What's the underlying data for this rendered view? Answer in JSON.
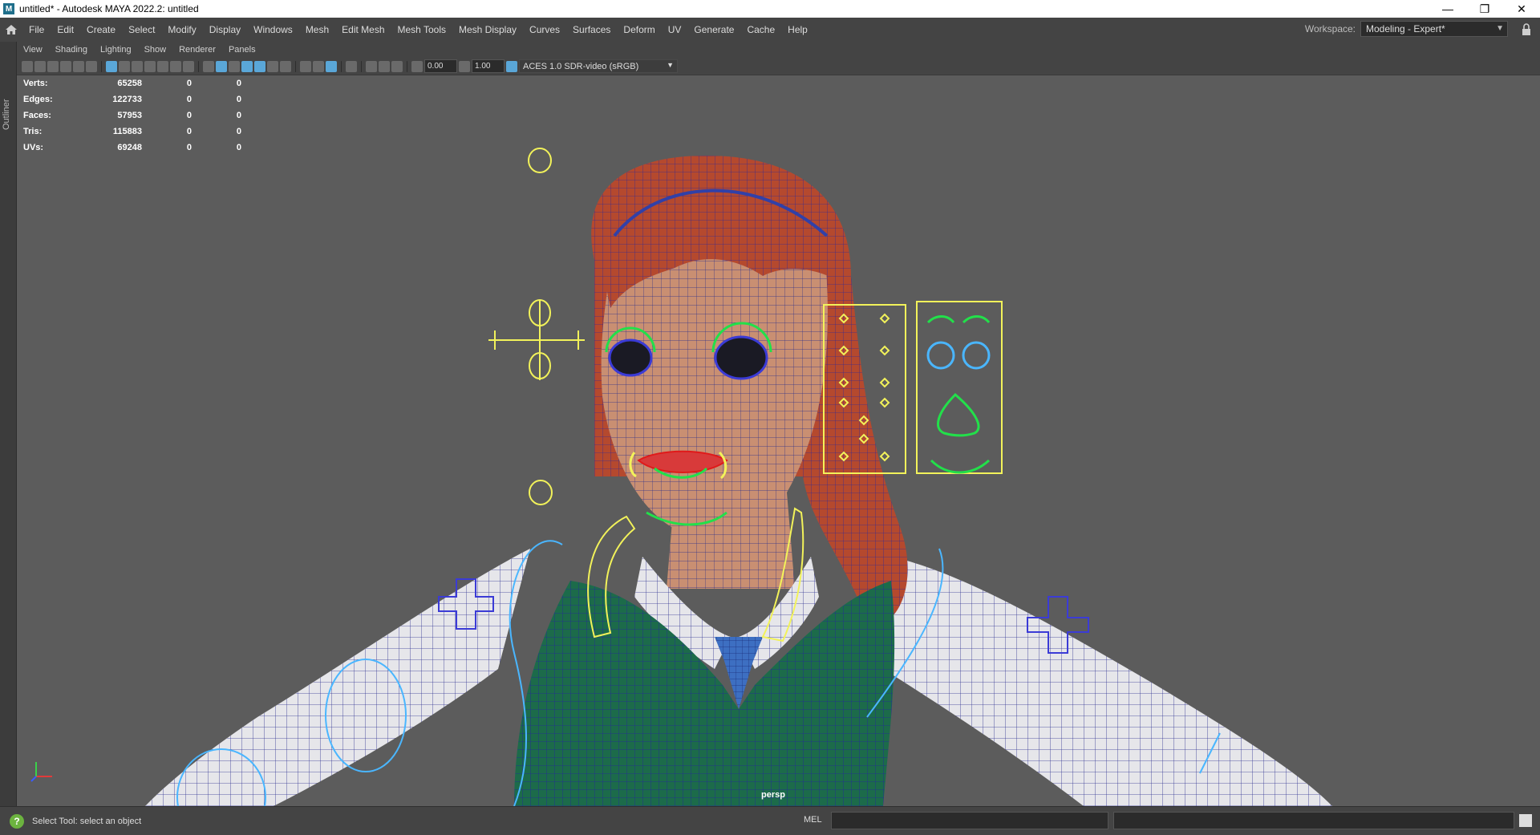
{
  "window": {
    "title": "untitled* - Autodesk MAYA 2022.2: untitled",
    "app_icon": "M"
  },
  "menu": {
    "items": [
      "File",
      "Edit",
      "Create",
      "Select",
      "Modify",
      "Display",
      "Windows",
      "Mesh",
      "Edit Mesh",
      "Mesh Tools",
      "Mesh Display",
      "Curves",
      "Surfaces",
      "Deform",
      "UV",
      "Generate",
      "Cache",
      "Help"
    ]
  },
  "workspace": {
    "label": "Workspace:",
    "value": "Modeling - Expert*"
  },
  "outliner": {
    "label": "Outliner"
  },
  "panel_menu": {
    "items": [
      "View",
      "Shading",
      "Lighting",
      "Show",
      "Renderer",
      "Panels"
    ]
  },
  "toolbar": {
    "exposure": "0.00",
    "gamma": "1.00",
    "color_space": "ACES 1.0 SDR-video (sRGB)"
  },
  "hud": {
    "rows": [
      {
        "label": "Verts:",
        "value": "65258",
        "sel": "0",
        "comp": "0"
      },
      {
        "label": "Edges:",
        "value": "122733",
        "sel": "0",
        "comp": "0"
      },
      {
        "label": "Faces:",
        "value": "57953",
        "sel": "0",
        "comp": "0"
      },
      {
        "label": "Tris:",
        "value": "115883",
        "sel": "0",
        "comp": "0"
      },
      {
        "label": "UVs:",
        "value": "69248",
        "sel": "0",
        "comp": "0"
      }
    ]
  },
  "viewport": {
    "camera": "persp"
  },
  "status": {
    "help_text": "Select Tool: select an object",
    "mel_label": "MEL"
  },
  "colors": {
    "control_yellow": "#f2f25a",
    "control_green": "#22e04a",
    "control_blue": "#3b3bd6",
    "curve_cyan": "#4ab6ff",
    "hair": "#b5492e",
    "vest": "#1c6b4a"
  }
}
